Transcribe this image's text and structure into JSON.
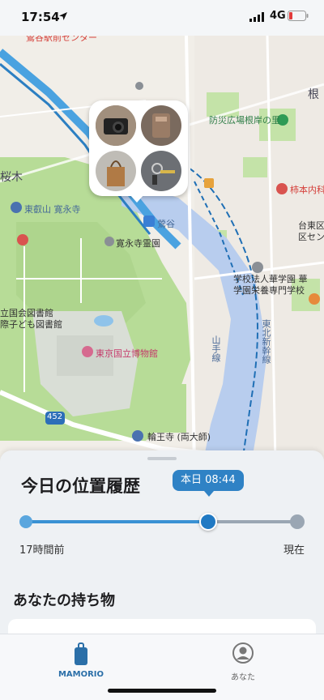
{
  "status_bar": {
    "time": "17:54",
    "network": "4G",
    "icons": [
      "location-arrow-icon",
      "signal-bars-icon",
      "battery-icon"
    ]
  },
  "map": {
    "labels": {
      "top_cut": "鶯谷駅前センター",
      "bousai": "防災広場根岸の里",
      "sakuragi": "桜木",
      "higashi_eizan": "東叡山 寛永寺",
      "kaneiji_cemetery": "寛永寺霊園",
      "uguisudani": "鶯谷",
      "kakimoto": "柿本内科",
      "taito_office": "台東区",
      "taito_office_2": "区センター",
      "gakko_1": "学校法人華学園 華",
      "gakko_2": "学園栄養専門学校",
      "library_1": "立国会図書館",
      "library_2": "際子ども図書館",
      "museum": "東京国立博物館",
      "tohoku_shinkansen": "東北新幹線",
      "yamanote": "山手線",
      "route": "452",
      "rinnoji": "輪王寺 (両大師)",
      "ne": "根"
    },
    "cluster_items": [
      "camera",
      "wallet",
      "tote-bag",
      "keys"
    ]
  },
  "sheet": {
    "title": "今日の位置履歴",
    "time_badge": "本日 08:44",
    "slider_value": 0.67,
    "slider_left_label": "17時間前",
    "slider_right_label": "現在",
    "belongings_title": "あなたの持ち物"
  },
  "tabbar": {
    "tabs": [
      {
        "label": "MAMORIO",
        "icon": "mamorio-tag-icon",
        "active": true
      },
      {
        "label": "あなた",
        "icon": "user-profile-icon",
        "active": false
      }
    ]
  },
  "colors": {
    "accent": "#2f82c5",
    "park": "#b9dd9a",
    "river": "#b9cdee",
    "rail_blue": "#4aa2e0"
  }
}
